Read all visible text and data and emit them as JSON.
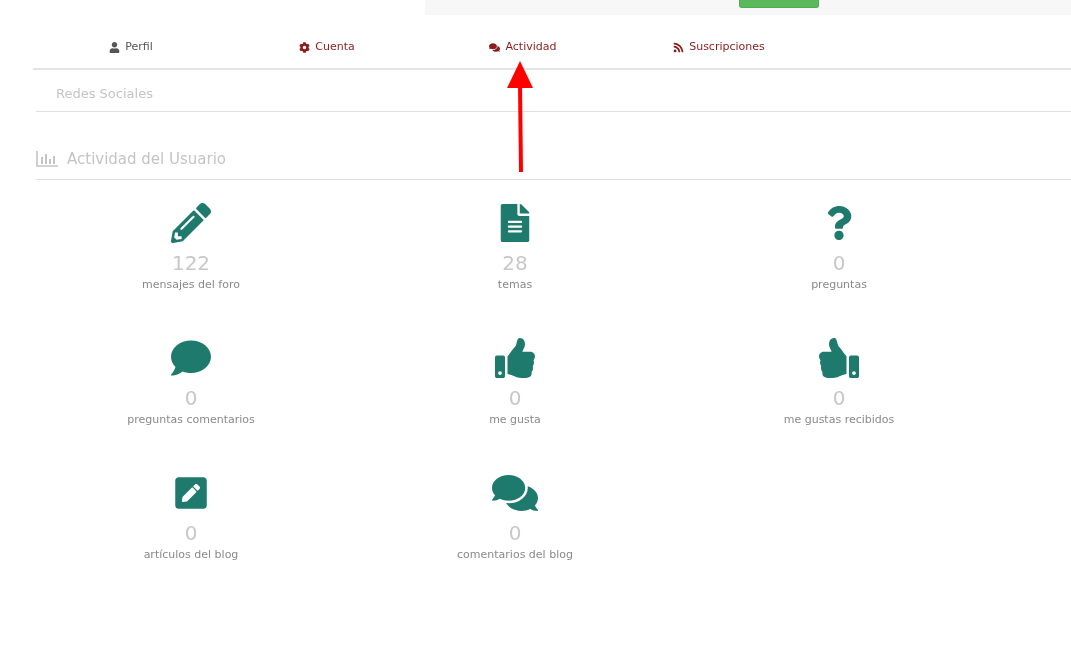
{
  "tabs": [
    {
      "label": "Perfil",
      "kind": "user",
      "selected": true
    },
    {
      "label": "Cuenta",
      "kind": "gear",
      "selected": false
    },
    {
      "label": "Actividad",
      "kind": "comments",
      "selected": false
    },
    {
      "label": "Suscripciones",
      "kind": "rss",
      "selected": false
    }
  ],
  "social_section": {
    "title": "Redes Sociales"
  },
  "activity_section": {
    "title": "Actividad del Usuario"
  },
  "stats": [
    {
      "kind": "pencil",
      "count": "122",
      "label": "mensajes del foro"
    },
    {
      "kind": "document",
      "count": "28",
      "label": "temas"
    },
    {
      "kind": "question",
      "count": "0",
      "label": "preguntas"
    },
    {
      "kind": "comment",
      "count": "0",
      "label": "preguntas comentarios"
    },
    {
      "kind": "thumbs-up",
      "count": "0",
      "label": "me gusta"
    },
    {
      "kind": "thumbs-up-mirrored",
      "count": "0",
      "label": "me gustas recibidos"
    },
    {
      "kind": "edit-square",
      "count": "0",
      "label": "artículos del blog"
    },
    {
      "kind": "comments",
      "count": "0",
      "label": "comentarios del blog"
    }
  ]
}
